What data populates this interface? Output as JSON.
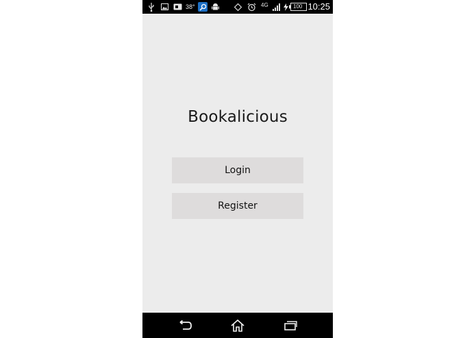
{
  "status_bar": {
    "icons": [
      "usb-icon",
      "image-icon",
      "sim-icon",
      "search-app-icon",
      "android-icon",
      "rotate-icon",
      "alarm-icon",
      "signal-icon",
      "battery-icon"
    ],
    "temperature": "38°",
    "network": "4G",
    "battery_level": "100",
    "time": "10:25"
  },
  "app": {
    "title": "Bookalicious",
    "login_label": "Login",
    "register_label": "Register"
  },
  "nav_bar": {
    "items": [
      "back-icon",
      "home-icon",
      "recent-apps-icon"
    ]
  },
  "colors": {
    "background": "#ececec",
    "button": "#dedcdc",
    "bars": "#000000"
  }
}
